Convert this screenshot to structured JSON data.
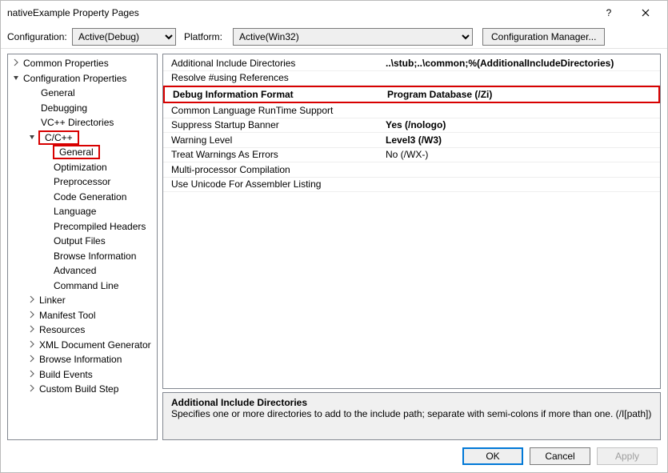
{
  "title": "nativeExample Property Pages",
  "config": {
    "config_label": "Configuration:",
    "config_value": "Active(Debug)",
    "platform_label": "Platform:",
    "platform_value": "Active(Win32)",
    "manager_btn": "Configuration Manager..."
  },
  "tree": {
    "common": "Common Properties",
    "configp": "Configuration Properties",
    "general_top": "General",
    "debugging": "Debugging",
    "vcpp": "VC++ Directories",
    "ccpp": "C/C++",
    "cc_general": "General",
    "cc_opt": "Optimization",
    "cc_pre": "Preprocessor",
    "cc_codegen": "Code Generation",
    "cc_lang": "Language",
    "cc_pch": "Precompiled Headers",
    "cc_out": "Output Files",
    "cc_browse": "Browse Information",
    "cc_adv": "Advanced",
    "cc_cmd": "Command Line",
    "linker": "Linker",
    "manifest": "Manifest Tool",
    "resources": "Resources",
    "xml": "XML Document Generator",
    "browse_info": "Browse Information",
    "build_events": "Build Events",
    "custom": "Custom Build Step"
  },
  "props": {
    "r1n": "Additional Include Directories",
    "r1v": "..\\stub;..\\common;%(AdditionalIncludeDirectories)",
    "r2n": "Resolve #using References",
    "r2v": "",
    "r3n": "Debug Information Format",
    "r3v": "Program Database (/Zi)",
    "r4n": "Common Language RunTime Support",
    "r4v": "",
    "r5n": "Suppress Startup Banner",
    "r5v": "Yes (/nologo)",
    "r6n": "Warning Level",
    "r6v": "Level3 (/W3)",
    "r7n": "Treat Warnings As Errors",
    "r7v": "No (/WX-)",
    "r8n": "Multi-processor Compilation",
    "r8v": "",
    "r9n": "Use Unicode For Assembler Listing",
    "r9v": ""
  },
  "desc": {
    "title": "Additional Include Directories",
    "body": "Specifies one or more directories to add to the include path; separate with semi-colons if more than one. (/I[path])"
  },
  "buttons": {
    "ok": "OK",
    "cancel": "Cancel",
    "apply": "Apply"
  }
}
